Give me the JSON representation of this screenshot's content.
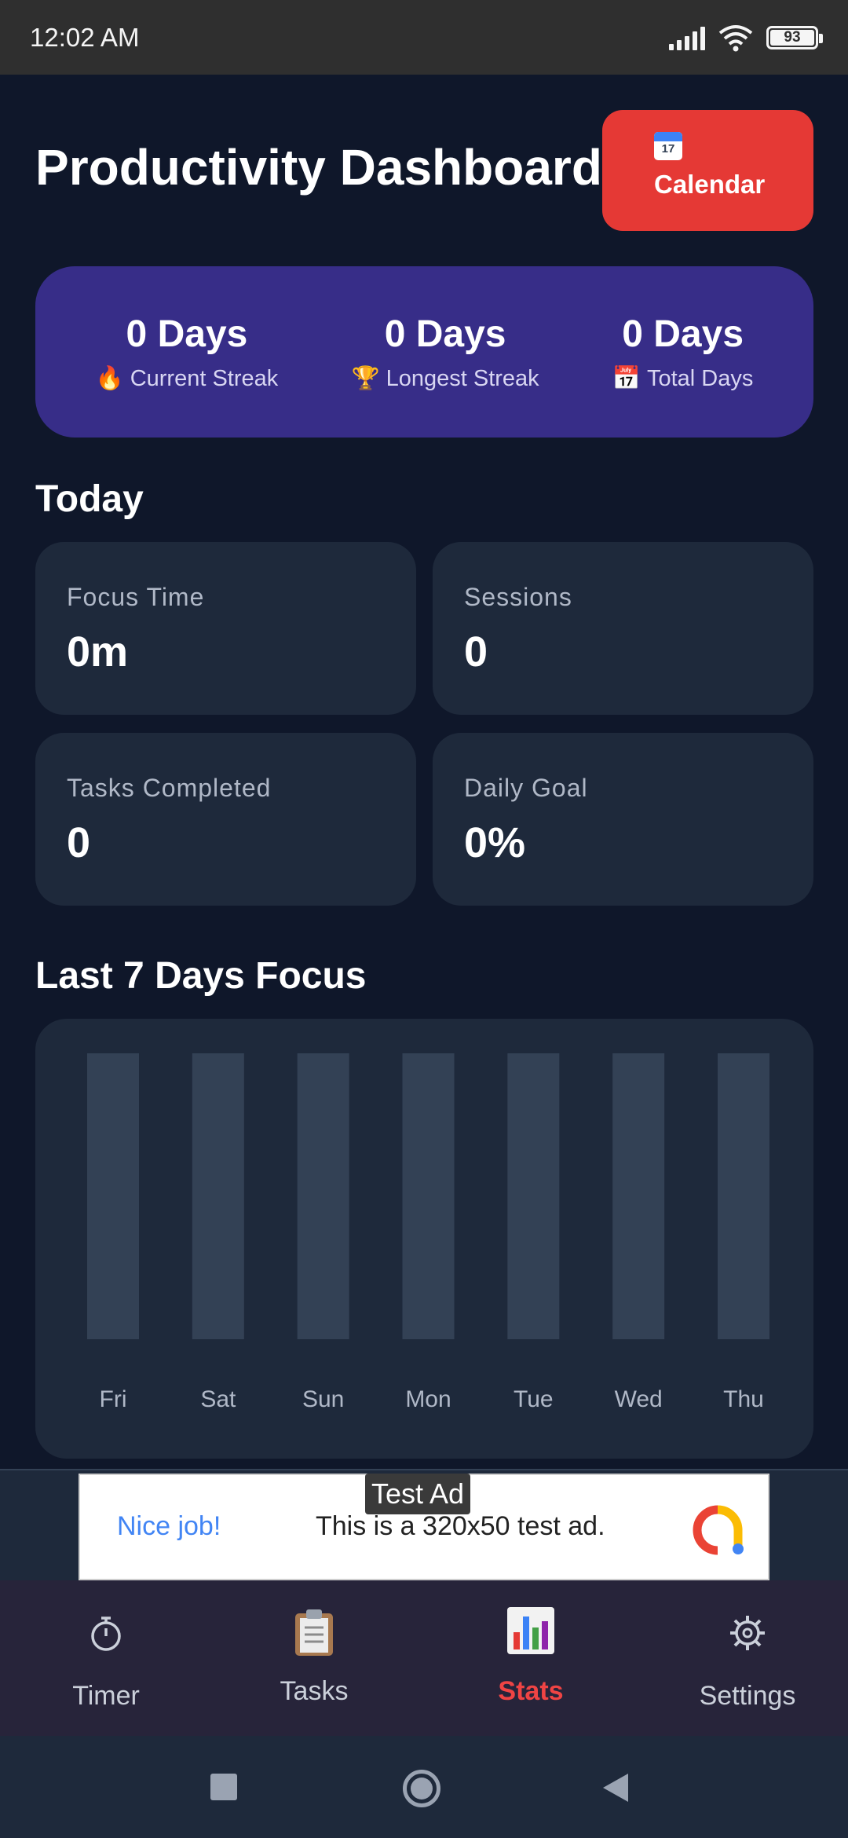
{
  "status_bar": {
    "time": "12:02 AM",
    "battery": "93"
  },
  "header": {
    "title": "Productivity Dashboard",
    "calendar_label": "Calendar",
    "calendar_icon_day": "17"
  },
  "streaks": [
    {
      "value": "0 Days",
      "emoji": "🔥",
      "label": "Current Streak"
    },
    {
      "value": "0 Days",
      "emoji": "🏆",
      "label": "Longest Streak"
    },
    {
      "value": "0 Days",
      "emoji": "📅",
      "label": "Total Days"
    }
  ],
  "today": {
    "title": "Today",
    "stats": [
      {
        "label": "Focus Time",
        "value": "0m"
      },
      {
        "label": "Sessions",
        "value": "0"
      },
      {
        "label": "Tasks Completed",
        "value": "0"
      },
      {
        "label": "Daily Goal",
        "value": "0%"
      }
    ]
  },
  "chart_section": {
    "title": "Last 7 Days Focus"
  },
  "chart_data": {
    "type": "bar",
    "categories": [
      "Fri",
      "Sat",
      "Sun",
      "Mon",
      "Tue",
      "Wed",
      "Thu"
    ],
    "values": [
      0,
      0,
      0,
      0,
      0,
      0,
      0
    ],
    "title": "Last 7 Days Focus",
    "xlabel": "",
    "ylabel": "",
    "colors": {
      "track": "#334155",
      "bar": "#4f46e5"
    }
  },
  "ad": {
    "tag": "Test Ad",
    "nice": "Nice job!",
    "text": "This is a 320x50 test ad."
  },
  "nav": {
    "items": [
      {
        "label": "Timer",
        "icon": "⏱"
      },
      {
        "label": "Tasks",
        "icon": "📋"
      },
      {
        "label": "Stats",
        "icon": "📊"
      },
      {
        "label": "Settings",
        "icon": "⚙"
      }
    ],
    "active_color": "#ef4444"
  }
}
